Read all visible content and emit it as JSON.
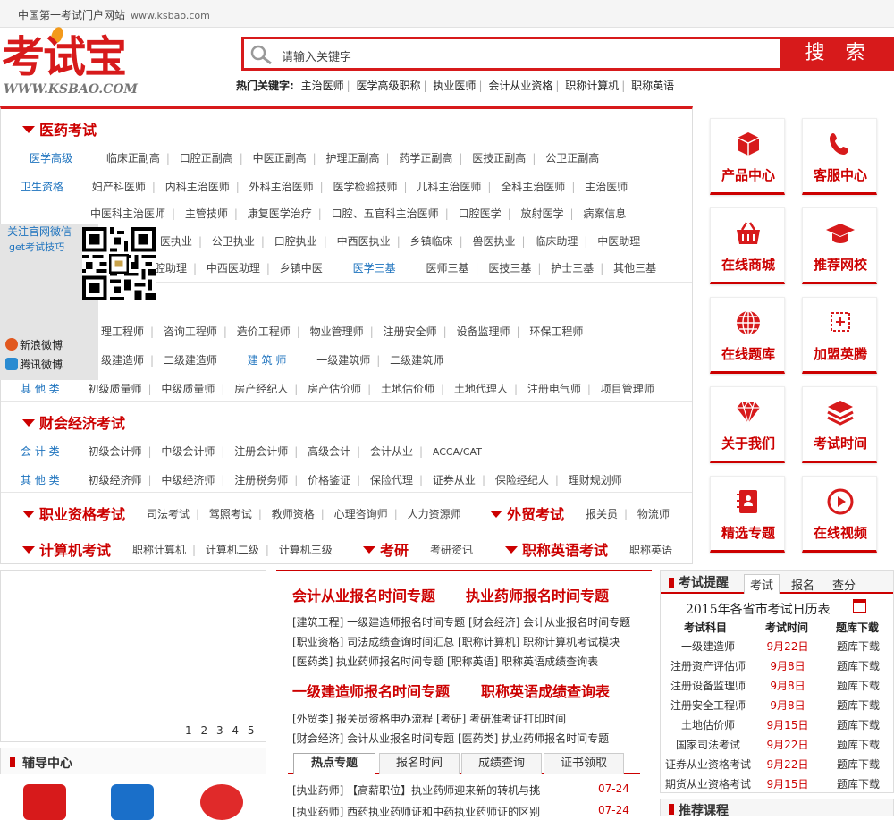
{
  "topbar": {
    "text": "中国第一考试门户网站",
    "url": "www.ksbao.com"
  },
  "logo": {
    "cn": "考试宝",
    "en": "WWW.KSBAO.COM"
  },
  "search": {
    "placeholder": "请输入关键字",
    "button": "搜 索"
  },
  "hot": {
    "label": "热门关键字:",
    "items": [
      "主治医师",
      "医学高级职称",
      "执业医师",
      "会计从业资格",
      "职称计算机",
      "职称英语"
    ]
  },
  "sections": {
    "med": {
      "title": "医药考试"
    },
    "cai": {
      "title": "财会经济考试"
    },
    "zhiye": {
      "title": "职业资格考试"
    },
    "waimao": {
      "title": "外贸考试"
    },
    "jisuanji": {
      "title": "计算机考试"
    },
    "kaoyan": {
      "title": "考研"
    },
    "english": {
      "title": "职称英语考试"
    }
  },
  "rows": {
    "r1": {
      "label": "医学高级",
      "items": [
        "临床正副高",
        "口腔正副高",
        "中医正副高",
        "护理正副高",
        "药学正副高",
        "医技正副高",
        "公卫正副高"
      ]
    },
    "r2": {
      "label": "卫生资格",
      "items": [
        "妇产科医师",
        "内科主治医师",
        "外科主治医师",
        "医学检验技师",
        "儿科主治医师",
        "全科主治医师",
        "主治医师"
      ]
    },
    "r3": {
      "items": [
        "中医科主治医师",
        "主管技师",
        "康复医学治疗",
        "口腔、五官科主治医师",
        "口腔医学",
        "放射医学",
        "病案信息"
      ]
    },
    "r4": {
      "items": [
        "医执业",
        "公卫执业",
        "口腔执业",
        "中西医执业",
        "乡镇临床",
        "兽医执业",
        "临床助理",
        "中医助理"
      ]
    },
    "r5": {
      "items": [
        "腔助理",
        "中西医助理",
        "乡镇中医"
      ],
      "blue": "医学三基",
      "items2": [
        "医师三基",
        "医技三基",
        "护士三基",
        "其他三基"
      ]
    },
    "r6": {
      "items": [
        "理工程师",
        "咨询工程师",
        "造价工程师",
        "物业管理师",
        "注册安全师",
        "设备监理师",
        "环保工程师"
      ]
    },
    "r7": {
      "items": [
        "级建造师",
        "二级建造师"
      ],
      "blue": "建 筑 师",
      "items2": [
        "一级建筑师",
        "二级建筑师"
      ]
    },
    "r8": {
      "label": "其 他 类",
      "items": [
        "初级质量师",
        "中级质量师",
        "房产经纪人",
        "房产估价师",
        "土地估价师",
        "土地代理人",
        "注册电气师",
        "项目管理师"
      ]
    },
    "r9": {
      "label": "会 计 类",
      "items": [
        "初级会计师",
        "中级会计师",
        "注册会计师",
        "高级会计",
        "会计从业",
        "ACCA/CAT"
      ]
    },
    "r10": {
      "label": "其 他 类",
      "items": [
        "初级经济师",
        "中级经济师",
        "注册税务师",
        "价格鉴证",
        "保险代理",
        "证券从业",
        "保险经纪人",
        "理财规划师"
      ]
    },
    "r11": {
      "items": [
        "司法考试",
        "驾照考试",
        "教师资格",
        "心理咨询师",
        "人力资源师"
      ]
    },
    "r11b": {
      "items": [
        "报关员",
        "物流师"
      ]
    },
    "r12": {
      "items": [
        "职称计算机",
        "计算机二级",
        "计算机三级"
      ]
    },
    "r12b": {
      "item": "考研资讯"
    },
    "r12c": {
      "item": "职称英语"
    }
  },
  "follow": {
    "line1": "关注官网微信",
    "line2": "get考试技巧",
    "weibo1": "新浪微博",
    "weibo2": "腾讯微博"
  },
  "tiles": [
    {
      "label": "产品中心",
      "icon": "cube-icon"
    },
    {
      "label": "客服中心",
      "icon": "phone-icon"
    },
    {
      "label": "在线商城",
      "icon": "basket-icon"
    },
    {
      "label": "推荐网校",
      "icon": "graduation-cap-icon"
    },
    {
      "label": "在线题库",
      "icon": "globe-icon"
    },
    {
      "label": "加盟英腾",
      "icon": "plus-box-icon"
    },
    {
      "label": "关于我们",
      "icon": "diamond-icon"
    },
    {
      "label": "考试时间",
      "icon": "layers-icon"
    },
    {
      "label": "精选专题",
      "icon": "book-icon"
    },
    {
      "label": "在线视频",
      "icon": "play-icon"
    }
  ],
  "pages": [
    "1",
    "2",
    "3",
    "4",
    "5"
  ],
  "fudao": {
    "title": "辅导中心"
  },
  "mid": {
    "h1a": "会计从业报名时间专题",
    "h1b": "执业药师报名时间专题",
    "l1": "[建筑工程] 一级建造师报名时间专题 [财会经济] 会计从业报名时间专题",
    "l2": "[职业资格] 司法成绩查询时间汇总 [职称计算机] 职称计算机考试模块",
    "l3": "[医药类] 执业药师报名时间专题 [职称英语] 职称英语成绩查询表",
    "h2a": "一级建造师报名时间专题",
    "h2b": "职称英语成绩查询表",
    "l4": "[外贸类] 报关员资格申办流程 [考研] 考研准考证打印时间",
    "l5": "[财会经济] 会计从业报名时间专题 [医药类] 执业药师报名时间专题",
    "tabs": [
      "热点专题",
      "报名时间",
      "成绩查询",
      "证书领取"
    ],
    "news": [
      {
        "text": "[执业药师] 【高薪职位】执业药师迎来新的转机与挑",
        "date": "07-24"
      },
      {
        "text": "[执业药师] 西药执业药师证和中药执业药师证的区别",
        "date": "07-24"
      }
    ]
  },
  "remind": {
    "title": "考试提醒",
    "tabs": [
      "考试",
      "报名",
      "查分"
    ],
    "cal_title": "2015年各省市考试日历表",
    "cal_icon": "calendar-icon",
    "cols": [
      "考试科目",
      "考试时间",
      "题库下载"
    ],
    "rows": [
      {
        "name": "一级建造师",
        "date": "9月22日",
        "dl": "题库下载"
      },
      {
        "name": "注册资产评估师",
        "date": "9月8日",
        "dl": "题库下载"
      },
      {
        "name": "注册设备监理师",
        "date": "9月8日",
        "dl": "题库下载"
      },
      {
        "name": "注册安全工程师",
        "date": "9月8日",
        "dl": "题库下载"
      },
      {
        "name": "土地估价师",
        "date": "9月15日",
        "dl": "题库下载"
      },
      {
        "name": "国家司法考试",
        "date": "9月22日",
        "dl": "题库下载"
      },
      {
        "name": "证券从业资格考试",
        "date": "9月22日",
        "dl": "题库下载"
      },
      {
        "name": "期货从业资格考试",
        "date": "9月15日",
        "dl": "题库下载"
      }
    ]
  },
  "tuijian": {
    "title": "推荐课程"
  },
  "colors": {
    "accent": "#d71a1b",
    "link": "#1e73be"
  }
}
